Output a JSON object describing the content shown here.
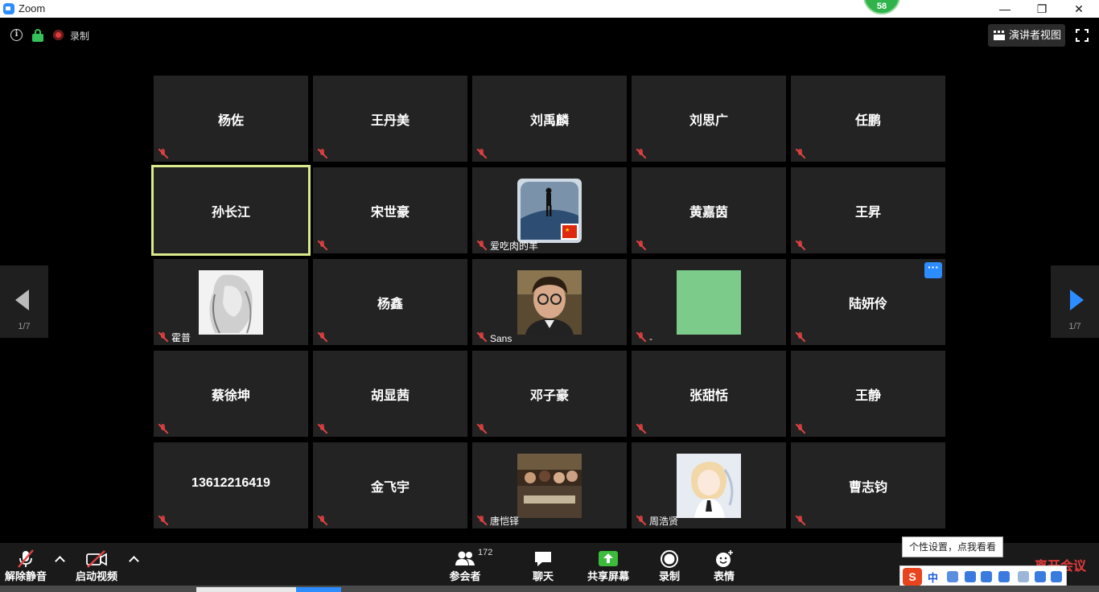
{
  "window": {
    "title": "Zoom",
    "timer": "58"
  },
  "top": {
    "recording_label": "录制",
    "speaker_view_label": "演讲者视图"
  },
  "grid": {
    "tiles": [
      {
        "name": "杨佐",
        "type": "text"
      },
      {
        "name": "王丹美",
        "type": "text"
      },
      {
        "name": "刘禹麟",
        "type": "text"
      },
      {
        "name": "刘思广",
        "type": "text"
      },
      {
        "name": "任鹏",
        "type": "text"
      },
      {
        "name": "孙长江",
        "type": "text",
        "active": true
      },
      {
        "name": "宋世豪",
        "type": "text"
      },
      {
        "name": "爱吃肉的羊",
        "type": "avatar",
        "avatar": "landscape-avatar"
      },
      {
        "name": "黄嘉茵",
        "type": "text"
      },
      {
        "name": "王昇",
        "type": "text"
      },
      {
        "name": "霍普",
        "type": "avatar",
        "avatar": "sketch-avatar"
      },
      {
        "name": "杨鑫",
        "type": "text"
      },
      {
        "name": "Sans",
        "type": "avatar",
        "avatar": "photo-avatar"
      },
      {
        "name": "-",
        "type": "avatar",
        "avatar": "green-avatar"
      },
      {
        "name": "陆妍伶",
        "type": "text",
        "more": true
      },
      {
        "name": "蔡徐坤",
        "type": "text"
      },
      {
        "name": "胡显茜",
        "type": "text"
      },
      {
        "name": "邓子豪",
        "type": "text"
      },
      {
        "name": "张甜恬",
        "type": "text"
      },
      {
        "name": "王静",
        "type": "text"
      },
      {
        "name": "13612216419",
        "type": "text"
      },
      {
        "name": "金飞宇",
        "type": "text"
      },
      {
        "name": "唐恺铎",
        "type": "avatar",
        "avatar": "group-photo-avatar"
      },
      {
        "name": "周浩贤",
        "type": "avatar",
        "avatar": "anime-avatar"
      },
      {
        "name": "曹志钧",
        "type": "text"
      }
    ]
  },
  "pager": {
    "left_label": "1/7",
    "right_label": "1/7"
  },
  "toolbar": {
    "unmute": "解除静音",
    "start_video": "启动视频",
    "participants": "参会者",
    "participants_count": "172",
    "chat": "聊天",
    "share_screen": "共享屏幕",
    "record": "录制",
    "reactions": "表情",
    "end_meeting": "离开会议"
  },
  "ime": {
    "tooltip": "个性设置，点我看看",
    "mode": "中"
  },
  "colors": {
    "accent": "#2d8cff",
    "active_border": "#d9ea8a",
    "muted_red": "#e04444",
    "share_green": "#3dbb3d",
    "end_red": "#e23b3b"
  }
}
